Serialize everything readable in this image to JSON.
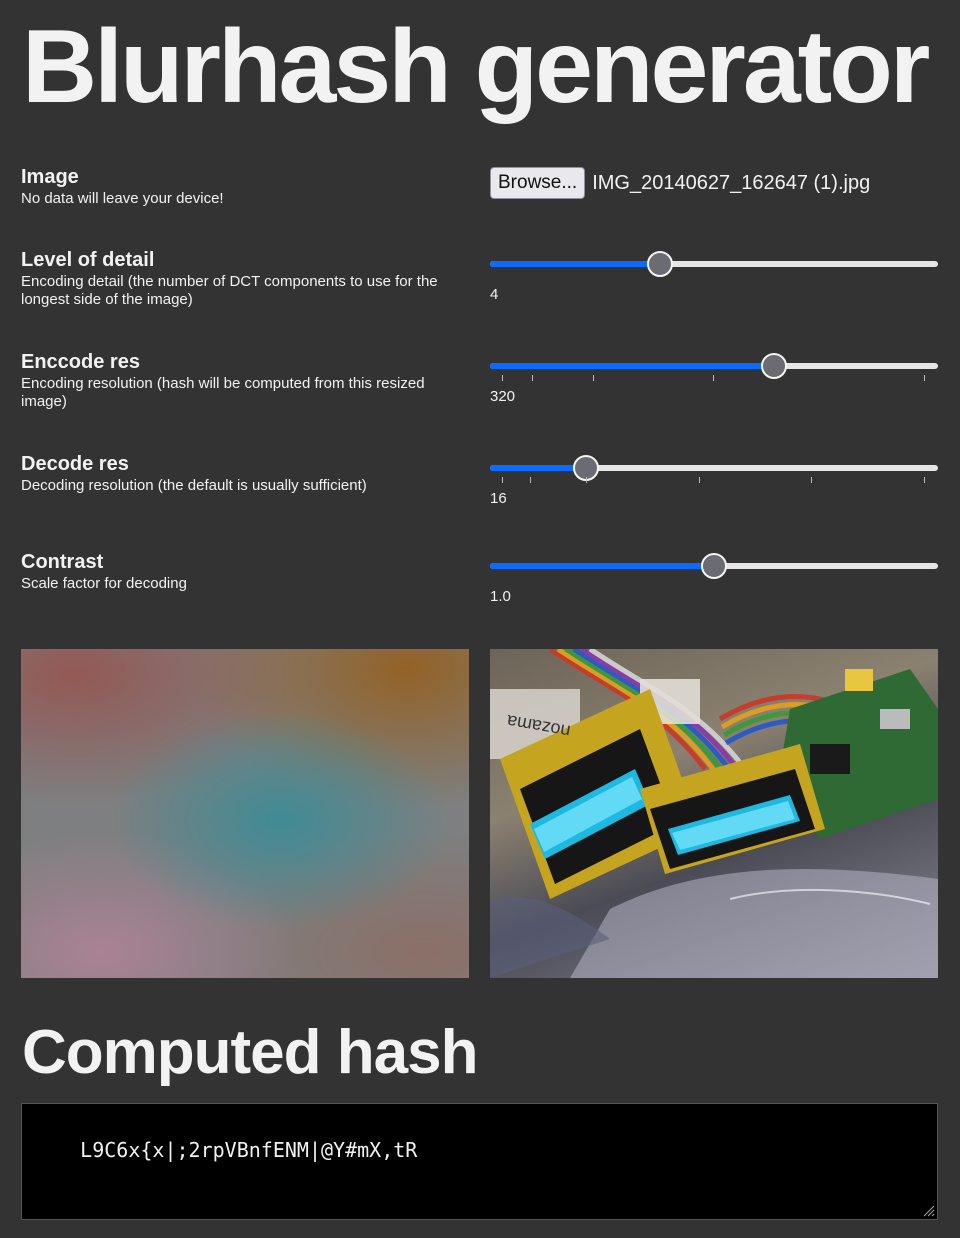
{
  "header": {
    "title": "Blurhash generator"
  },
  "image": {
    "label": "Image",
    "description": "No data will leave your device!",
    "browse_label": "Browse...",
    "file_name": "IMG_20140627_162647 (1).jpg"
  },
  "level_of_detail": {
    "label": "Level of detail",
    "description": "Encoding detail (the number of DCT components to use for the longest side of the image)",
    "value": "4",
    "position_fraction": 0.38
  },
  "encode_res": {
    "label": "Enccode res",
    "description": "Encoding resolution (hash will be computed from this resized image)",
    "value": "320",
    "position_fraction": 0.635
  },
  "decode_res": {
    "label": "Decode res",
    "description": "Decoding resolution (the default is usually sufficient)",
    "value": "16",
    "position_fraction": 0.215
  },
  "contrast": {
    "label": "Contrast",
    "description": "Scale factor for decoding",
    "value": "1.0",
    "position_fraction": 0.5
  },
  "output": {
    "title": "Computed hash",
    "hash": "L9C6x{x|;2rpVBnfENM|@Y#mX,tR"
  },
  "colors": {
    "background": "#333333",
    "accent": "#0a6cff",
    "text": "#f2f2f2",
    "hash_background": "#000000"
  }
}
